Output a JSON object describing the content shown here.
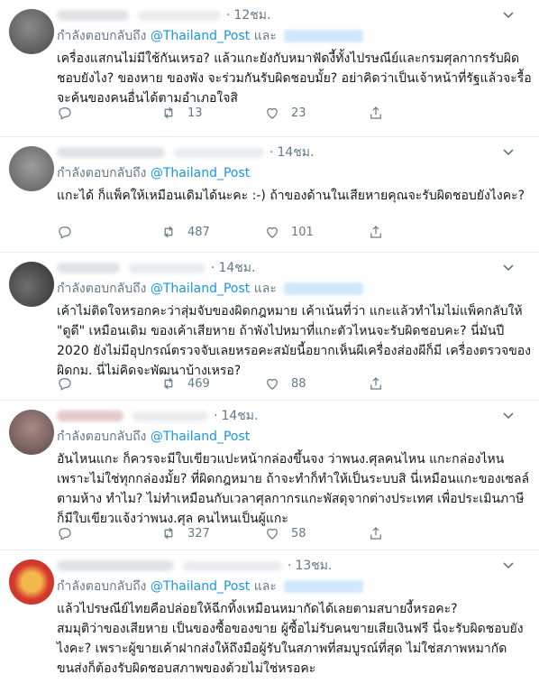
{
  "reply_prefix": "กำลังตอบกลับถึง",
  "conjunction": "และ",
  "icons": {
    "reply": "reply-icon",
    "retweet": "retweet-icon",
    "like": "like-icon",
    "share": "share-icon",
    "more": "chevron-down-icon"
  },
  "tweets": [
    {
      "time": "12ชม.",
      "mention": "@Thailand_Post",
      "text": "เครื่องแสกนไม่มีใช้กันเหรอ? แล้วแกะยังกับหมาฟัดงี้ทั้งไปรษณีย์และกรมศุลกากรรับผิดชอบยังไง? ของหาย ของพัง จะร่วมกันรับผิดชอบมั้ย? อย่าคิดว่าเป็นเจ้าหน้าที่รัฐแล้วจะรื้อจะค้นของคนอื่นได้ตามอำเภอใจสิ",
      "retweets": "13",
      "likes": "23"
    },
    {
      "time": "14ชม.",
      "mention": "@Thailand_Post",
      "text": "แกะได้ ก็แพ็คให้เหมือนเดิมได้นะคะ :-) ถ้าของด้านในเสียหายคุณจะรับผิดชอบยังไงคะ?",
      "retweets": "487",
      "likes": "101"
    },
    {
      "time": "14ชม.",
      "mention": "@Thailand_Post",
      "text": "เค้าไม่ติดใจหรอกคะว่าสุ่มจับของผิดกฎหมาย เค้าเน้นที่ว่า แกะแล้วทำไมไม่แพ็คกลับให้ \"ดูดี\" เหมือนเดิม ของเค้าเสียหาย ถ้าพังไปหมาที่แกะตัวไหนจะรับผิดชอบคะ? นี่มันปี 2020 ยังไม่มีอุปกรณ์ตรวจจับเลยหรอคะสมัยนี้อยากเห็นผีเครื่องส่องผีก็มี เครื่องตรวจของผิดกม. นี่ไม่คิดจะพัฒนาบ้างเหรอ?",
      "retweets": "469",
      "likes": "88"
    },
    {
      "time": "14ชม.",
      "mention": "@Thailand_Post",
      "text": "อันไหนแกะ ก็ควรจะมีใบเขียวแปะหน้ากล่องขึ้นจง ว่าพนง.ศุลคนไหน แกะกล่องไหน เพราะไม่ใช่ทุกกล่องมั้ย? ที่ผิดกฎหมาย ถ้าจะทำก็ทำให้เป็นระบบสิ นี่เหมือนแกะของเซลล์ตามห้าง ทำไม? ไม่ทำเหมือนกับเวลาศุลกากรแกะพัสดุจากต่างประเทศ เพื่อประเมินภาษี ก็มีใบเขียวแจ้งว่าพนง.ศุล คนไหนเป็นผู้แกะ",
      "retweets": "327",
      "likes": "58"
    },
    {
      "time": "13ชม.",
      "mention": "@Thailand_Post",
      "text": "แล้วไปรษณีย์ไทยคือปล่อยให้ฉีกทิ้งเหมือนหมากัดได้เลยตามสบายงี้หรอคะ?\nสมมุติว่าของเสียหาย เป็นของซื้อของขาย ผู้ซื้อไม่รับคนขายเสียเงินฟรี นี่จะรับผิดชอบยังไงคะ? เพราะผู้ขายเค้าฝากส่งให้ถึงมือผู้รับในสภาพที่สมบูรณ์ที่สุด ไม่ใช่สภาพหมากัด\nขนส่งก็ต้องรับผิดชอบสภาพของด้วยไม่ใช่หรอคะ",
      "retweets": "",
      "likes": ""
    }
  ]
}
